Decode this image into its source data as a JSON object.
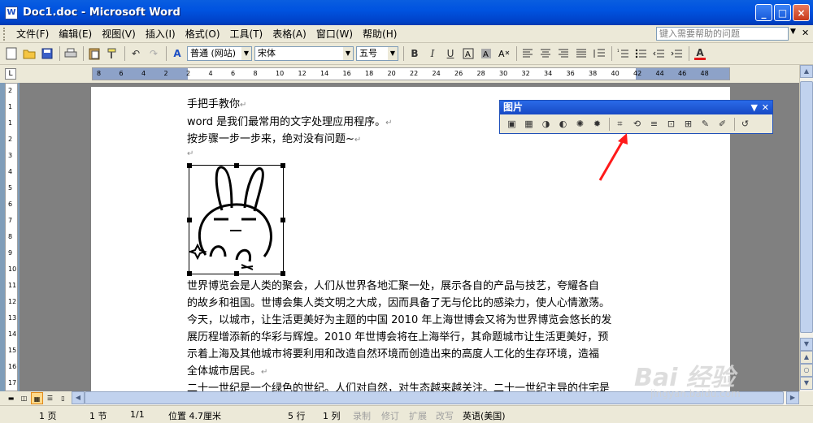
{
  "window": {
    "title": "Doc1.doc - Microsoft Word",
    "app_icon": "W",
    "controls": {
      "minimize": "_",
      "maximize": "□",
      "close": "×"
    }
  },
  "menubar": {
    "items": [
      "文件(F)",
      "编辑(E)",
      "视图(V)",
      "插入(I)",
      "格式(O)",
      "工具(T)",
      "表格(A)",
      "窗口(W)",
      "帮助(H)"
    ],
    "help_placeholder": "键入需要帮助的问题"
  },
  "toolbar": {
    "style_value": "普通 (网站)",
    "font_value": "宋体",
    "size_value": "五号",
    "icons": [
      "new-icon",
      "open-icon",
      "save-icon",
      "print-icon",
      "paste-icon",
      "format-painter-icon",
      "undo-icon",
      "redo-icon"
    ],
    "format_buttons": {
      "bold": "B",
      "italic": "I",
      "underline": "U"
    }
  },
  "ruler": {
    "h_ticks": [
      "8",
      "6",
      "4",
      "2",
      "2",
      "4",
      "6",
      "8",
      "10",
      "12",
      "14",
      "16",
      "18",
      "20",
      "22",
      "24",
      "26",
      "28",
      "30",
      "32",
      "34",
      "36",
      "38",
      "40",
      "42",
      "44",
      "46",
      "48"
    ],
    "v_ticks": [
      "2",
      "1",
      "1",
      "2",
      "3",
      "4",
      "5",
      "6",
      "7",
      "8",
      "9",
      "10",
      "11",
      "12",
      "13",
      "14",
      "15",
      "16",
      "17",
      "18"
    ]
  },
  "document": {
    "lines": [
      "手把手教你",
      "word 是我们最常用的文字处理应用程序。",
      "按步骤一步一步来，绝对没有问题~",
      "",
      "世界博览会是人类的聚会，人们从世界各地汇聚一处，展示各自的产品与技艺，夸耀各自",
      "的故乡和祖国。世博会集人类文明之大成，因而具备了无与伦比的感染力，使人心情激荡。",
      "今天，以城市，让生活更美好为主题的中国 2010 年上海世博会又将为世界博览会悠长的发",
      "展历程增添新的华彩与辉煌。2010 年世博会将在上海举行，其命题城市让生活更美好，预",
      "示着上海及其他城市将要利用和改造自然环境而创造出来的高度人工化的生存环境，造福",
      "全体城市居民。",
      "二十一世纪是一个绿色的世纪。人们对自然，对生态越来越关注。二十一世纪主导的住宅是"
    ],
    "paragraph_mark": "↵"
  },
  "picture_toolbar": {
    "title": "图片",
    "icons": [
      "insert-picture-icon",
      "color-icon",
      "more-contrast-icon",
      "less-contrast-icon",
      "more-brightness-icon",
      "less-brightness-icon",
      "crop-icon",
      "rotate-icon",
      "line-style-icon",
      "compress-icon",
      "text-wrapping-icon",
      "format-picture-icon",
      "set-transparent-color-icon",
      "reset-picture-icon"
    ]
  },
  "statusbar": {
    "page": "1 页",
    "section": "1 节",
    "page_of": "1/1",
    "position": "位置 4.7厘米",
    "line": "5 行",
    "column": "1 列",
    "rec": "录制",
    "trk": "修订",
    "ext": "扩展",
    "ovr": "改写",
    "language": "英语(美国)"
  },
  "watermark": {
    "logo": "Bai 经验",
    "url": "jingyan.baidu.com"
  },
  "colors": {
    "title_bar": "#0053e0",
    "chrome": "#ece9d8",
    "annotation_arrow": "#ff1a1a"
  }
}
